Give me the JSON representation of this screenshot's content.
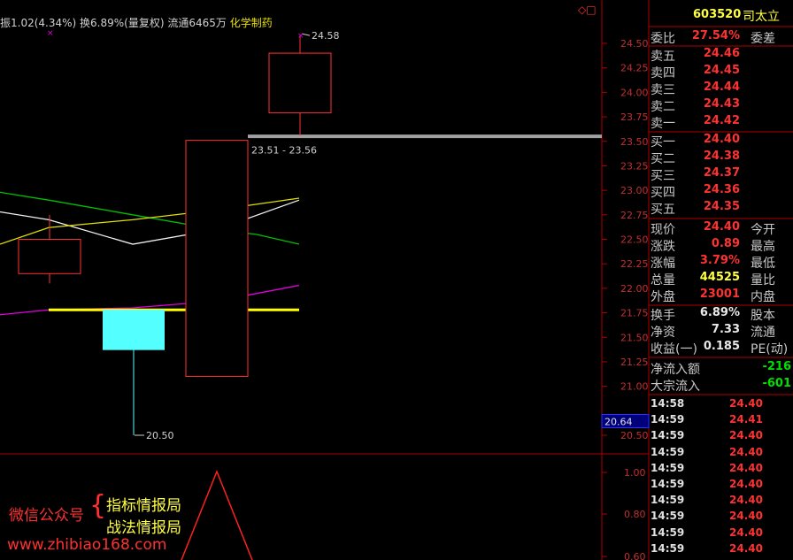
{
  "header": {
    "amplitude": "振1.02(4.34%)",
    "turnover": "换6.89%(量复权)",
    "float": "流通6465万",
    "industry": "化学制药"
  },
  "top_icons": "◇□",
  "chart_data": {
    "type": "candlestick",
    "title": "",
    "ylim": [
      20.3,
      24.7
    ],
    "y_ticks": [
      "24.50",
      "24.25",
      "24.00",
      "23.75",
      "23.50",
      "23.25",
      "23.00",
      "22.75",
      "22.50",
      "22.25",
      "22.00",
      "21.75",
      "21.50",
      "21.25",
      "21.00",
      "20.50"
    ],
    "candles": [
      {
        "open": 22.15,
        "close": 22.5,
        "high": 22.75,
        "low": 22.05,
        "color": "red-hollow"
      },
      {
        "open": 21.78,
        "close": 21.37,
        "high": 21.78,
        "low": 20.5,
        "color": "cyan"
      },
      {
        "open": 21.1,
        "close": 23.51,
        "high": 23.51,
        "low": 21.1,
        "color": "red-hollow"
      },
      {
        "open": 23.79,
        "close": 24.4,
        "high": 24.58,
        "low": 23.56,
        "color": "red-hollow"
      }
    ],
    "ma_lines": [
      {
        "color": "#00c000",
        "values": [
          22.98,
          22.9,
          22.75,
          22.6,
          22.55,
          22.45
        ]
      },
      {
        "color": "#f0f0f0",
        "values": [
          22.78,
          22.7,
          22.45,
          22.6,
          22.9
        ]
      },
      {
        "color": "#e0e000",
        "values": [
          22.45,
          22.62,
          22.7,
          22.8,
          22.92
        ]
      },
      {
        "color": "#e000e0",
        "values": [
          21.73,
          21.78,
          21.8,
          21.87,
          22.03
        ]
      }
    ],
    "support_line": 21.78,
    "gap_label": "23.51 - 23.56",
    "high_label": "24.58",
    "low_label": "20.50",
    "current_price_marker": "20.64",
    "sub_ticks": [
      "1.00",
      "0.80",
      "0.60"
    ]
  },
  "panel": {
    "code": "603520",
    "name": "司太立",
    "weibi_label": "委比",
    "weibi_value": "27.54%",
    "weicha_label": "委差",
    "sells": [
      {
        "label": "卖五",
        "price": "24.46"
      },
      {
        "label": "卖四",
        "price": "24.45"
      },
      {
        "label": "卖三",
        "price": "24.44"
      },
      {
        "label": "卖二",
        "price": "24.43"
      },
      {
        "label": "卖一",
        "price": "24.42"
      }
    ],
    "buys": [
      {
        "label": "买一",
        "price": "24.40"
      },
      {
        "label": "买二",
        "price": "24.38"
      },
      {
        "label": "买三",
        "price": "24.37"
      },
      {
        "label": "买四",
        "price": "24.36"
      },
      {
        "label": "买五",
        "price": "24.35"
      }
    ],
    "stats": [
      {
        "label": "现价",
        "value": "24.40",
        "label2": "今开",
        "cls": "red"
      },
      {
        "label": "涨跌",
        "value": "0.89",
        "label2": "最高",
        "cls": "red"
      },
      {
        "label": "涨幅",
        "value": "3.79%",
        "label2": "最低",
        "cls": "red"
      },
      {
        "label": "总量",
        "value": "44525",
        "label2": "量比",
        "cls": "yellow"
      },
      {
        "label": "外盘",
        "value": "23001",
        "label2": "内盘",
        "cls": "red"
      }
    ],
    "stats2": [
      {
        "label": "换手",
        "value": "6.89%",
        "label2": "股本"
      },
      {
        "label": "净资",
        "value": "7.33",
        "label2": "流通"
      },
      {
        "label": "收益(一)",
        "value": "0.185",
        "label2": "PE(动)"
      }
    ],
    "flows": [
      {
        "label": "净流入额",
        "value": "-216"
      },
      {
        "label": "大宗流入",
        "value": "-601"
      }
    ],
    "ticks": [
      {
        "time": "14:58",
        "price": "24.40"
      },
      {
        "time": "14:59",
        "price": "24.41"
      },
      {
        "time": "14:59",
        "price": "24.40"
      },
      {
        "time": "14:59",
        "price": "24.40"
      },
      {
        "time": "14:59",
        "price": "24.40"
      },
      {
        "time": "14:59",
        "price": "24.40"
      },
      {
        "time": "14:59",
        "price": "24.40"
      },
      {
        "time": "14:59",
        "price": "24.40"
      },
      {
        "time": "14:59",
        "price": "24.40"
      },
      {
        "time": "14:59",
        "price": "24.40"
      }
    ]
  },
  "watermark": {
    "label": "微信公众号",
    "brace": "{",
    "line1": "指标情报局",
    "line2": "战法情报局",
    "url": "www.zhibiao168.com"
  }
}
